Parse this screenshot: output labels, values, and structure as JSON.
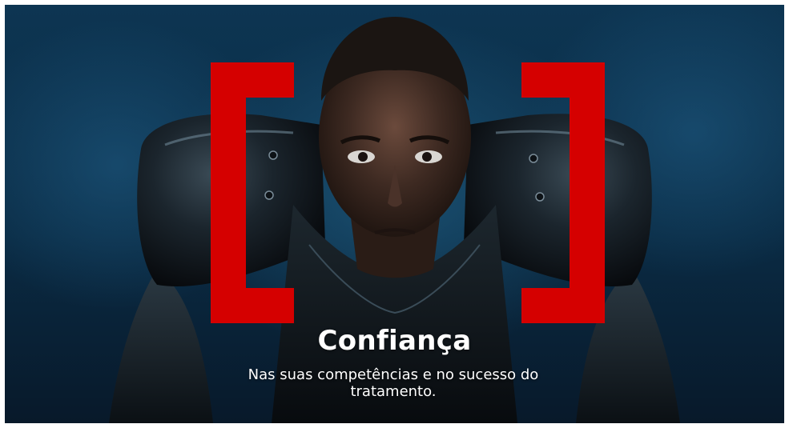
{
  "hero": {
    "title": "Confiança",
    "subtitle": "Nas suas competências e no sucesso do tratamento.",
    "image_subject": "athlete-portrait",
    "accent_color": "#d50000"
  }
}
